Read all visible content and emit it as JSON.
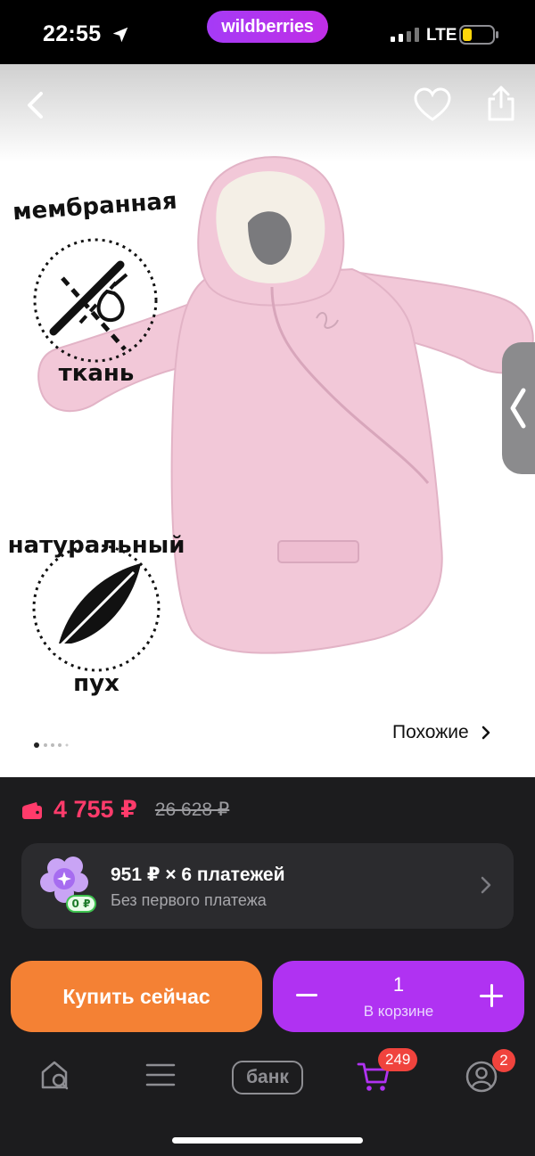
{
  "status_bar": {
    "time": "22:55",
    "brand": "wildberries",
    "network": "LTE"
  },
  "product": {
    "badge_top": "мембранная ткань",
    "badge_bottom": "натуральный пух",
    "similar_label": "Похожие",
    "colors": {
      "garment": "#f2c8d8",
      "fur": "#f4efe6"
    }
  },
  "price": {
    "current": "4 755 ₽",
    "old": "26 628 ₽",
    "color": "#ff3b6b"
  },
  "installment": {
    "title": "951 ₽ × 6 платежей",
    "subtitle": "Без первого платежа",
    "badge": "0 ₽"
  },
  "actions": {
    "buy_now": "Купить сейчас",
    "cart_quantity": "1",
    "cart_label": "В корзине"
  },
  "tabbar": {
    "bank_label": "банк",
    "cart_badge": "249",
    "profile_badge": "2"
  },
  "colors": {
    "accent": "#b032f2",
    "buy": "#f48134",
    "badge": "#f0433d"
  }
}
